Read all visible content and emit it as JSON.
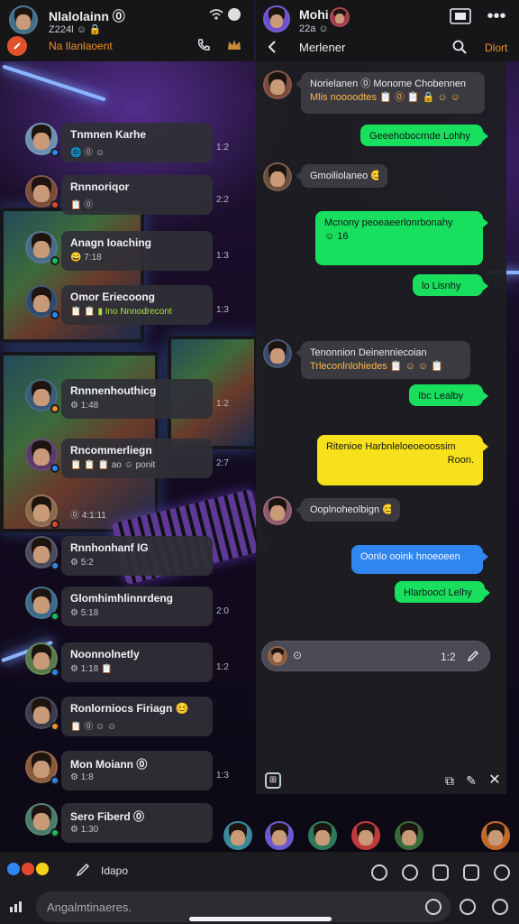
{
  "colors": {
    "accent_orange": "#f0902a",
    "bubble_green": "#18e05e",
    "bubble_yellow": "#f6e11c",
    "bubble_blue": "#2f86f0",
    "panel": "#161618"
  },
  "left_header": {
    "title": "Nlalolainn ⓪",
    "subtitle": "Z224l ☺ 🔒",
    "orange_label": "Na Ilanlaoent",
    "icons": [
      "wifi-icon",
      "battery-icon",
      "phone-icon",
      "crown-icon"
    ]
  },
  "right_header": {
    "title": "Mohi 🎮",
    "subtitle": "22a ☺",
    "orange_label": "Dlort",
    "chat_name": "Merlener",
    "icons": [
      "back-icon",
      "search-icon",
      "cast-icon",
      "more-icon"
    ]
  },
  "chat_list": [
    {
      "name": "Tnmnen Karhe",
      "preview": "🌐 ⓪ ☺",
      "time": "1:2"
    },
    {
      "name": "Rnnnoriqor",
      "preview": "📋 ⓪",
      "time": "2:2"
    },
    {
      "name": "Anagn Ioaching",
      "preview": "😀 7:18",
      "time": "1:3"
    },
    {
      "name": "Omor Eriecoong",
      "preview": "📋 📋 ▮ Ino Nnnodrecont",
      "time": "1:3"
    },
    {
      "name": "Rnnnenhouthicg",
      "preview": "⚙ 1:48",
      "time": "1:2"
    },
    {
      "name": "Rncommerliegn",
      "preview": "📋 📋 📋 ao ☺ ponit",
      "time": "2:7"
    },
    {
      "name": "",
      "preview": "⓪ 4:1:11",
      "time": ""
    },
    {
      "name": "Rnnhonhanf IG",
      "preview": "⚙ 5:2",
      "time": ""
    },
    {
      "name": "Glomhimhlinnrdeng",
      "preview": "⚙ 5:18",
      "time": "2:0"
    },
    {
      "name": "Noonnolnetly",
      "preview": "⚙ 1:18 📋",
      "time": "1:2"
    },
    {
      "name": "Ronlorniocs Firiagn 😊",
      "preview": "📋 ⓪ ☺ ☺",
      "time": ""
    },
    {
      "name": "Mon Moiann ⓪",
      "preview": "⚙ 1:8",
      "time": "1:3"
    },
    {
      "name": "Sero Fiberd ⓪",
      "preview": "⚙ 1:30",
      "time": ""
    }
  ],
  "messages": [
    {
      "type": "in",
      "text": "Norielanen ⓪ Monome Chobennen",
      "sub": "Mlis noooodtes 📋 ⓪ 📋 🔒 ☺ ☺",
      "time": ""
    },
    {
      "type": "green",
      "text": "Geeehobocrnde Lohhy",
      "time": ""
    },
    {
      "type": "in",
      "text": "Gmoiliolaneo 😊",
      "time": ""
    },
    {
      "type": "green",
      "text": "Mcnony peoeaeerlonrbonahy",
      "sub": "☺ 16",
      "time": ""
    },
    {
      "type": "green",
      "text": "lo Lisnhy",
      "time": ""
    },
    {
      "type": "in",
      "text": "Tenonnion Deinenniecoian",
      "sub": "Trleconlnlohiedes 📋 ☺ ☺ 📋",
      "time": ""
    },
    {
      "type": "green",
      "text": "Ibc Lealby",
      "time": ""
    },
    {
      "type": "yellow",
      "text": "Ritenioe Harbnleloeoeoossim",
      "sub": "Roon.",
      "time": ""
    },
    {
      "type": "in",
      "text": "Ooplnoheolbign 😊",
      "time": ""
    },
    {
      "type": "blue",
      "text": "Oonlo ooink hnoeoeen",
      "time": ""
    },
    {
      "type": "green",
      "text": "Hlarboocl Lelhy",
      "time": ""
    }
  ],
  "composer": {
    "time": "1:2"
  },
  "bottom": {
    "left_label": "Idapo",
    "search_placeholder": "Angalmtinaeres."
  }
}
